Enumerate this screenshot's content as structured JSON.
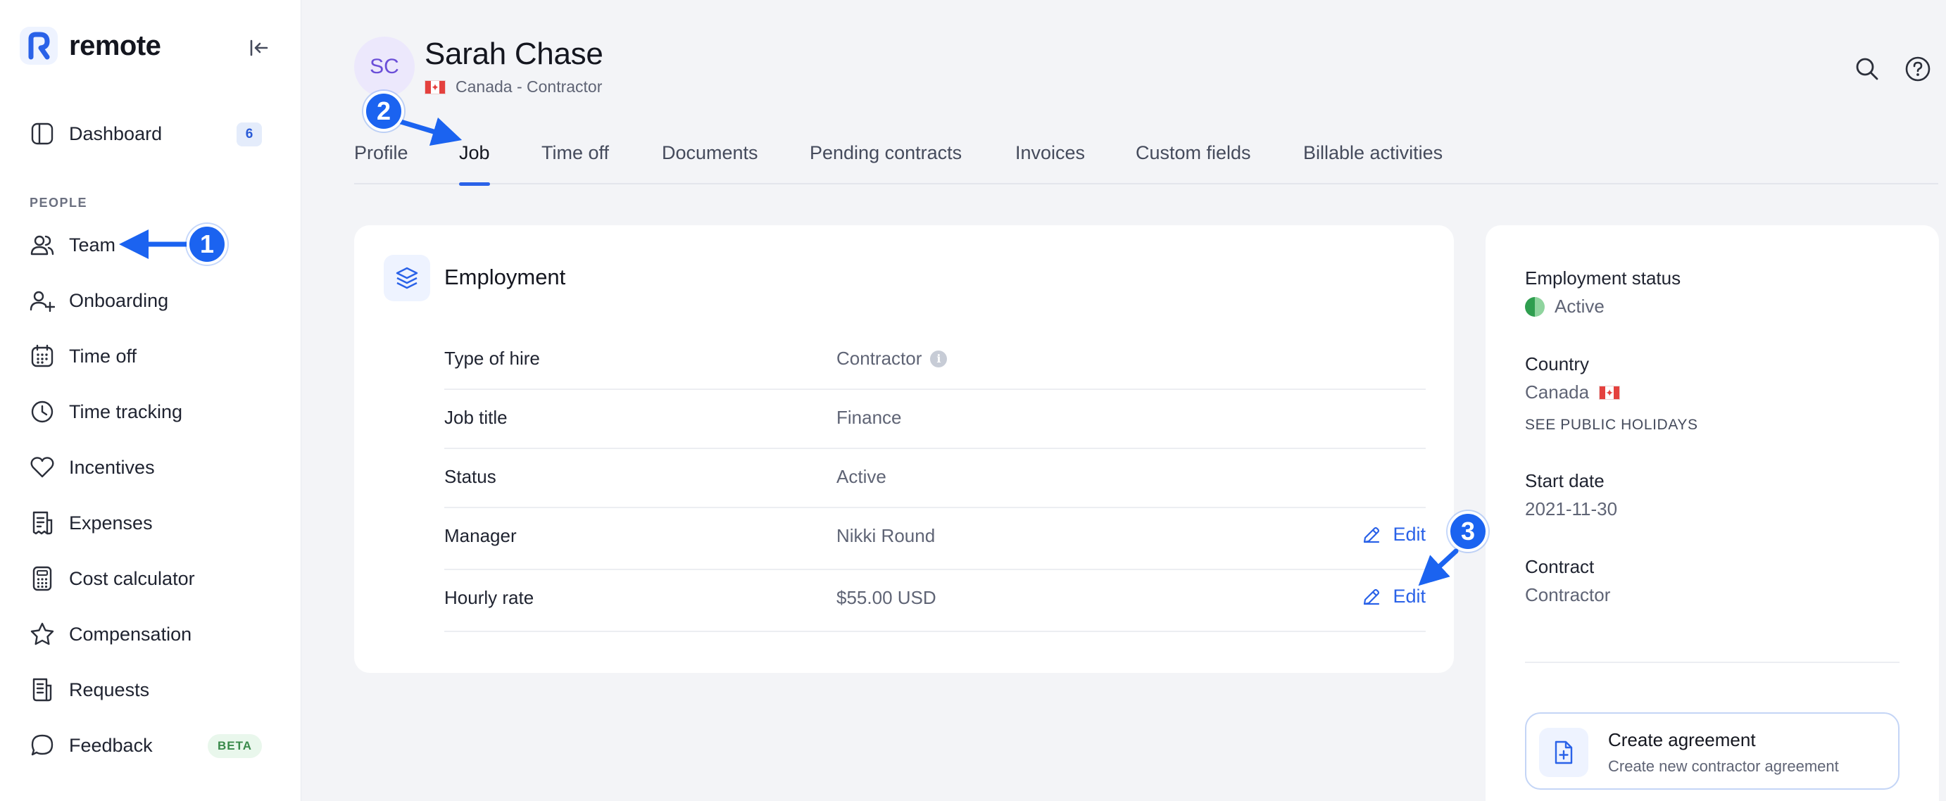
{
  "app": {
    "brand_name": "remote",
    "brand_color": "#2a62e8"
  },
  "sidebar": {
    "collapse_icon": "collapse-left-icon",
    "items_top": [
      {
        "label": "Dashboard",
        "icon": "dashboard-icon",
        "badge": "6"
      }
    ],
    "section_label": "PEOPLE",
    "items": [
      {
        "label": "Team",
        "icon": "team-icon"
      },
      {
        "label": "Onboarding",
        "icon": "add-user-icon"
      },
      {
        "label": "Time off",
        "icon": "calendar-icon"
      },
      {
        "label": "Time tracking",
        "icon": "clock-icon"
      },
      {
        "label": "Incentives",
        "icon": "heart-icon"
      },
      {
        "label": "Expenses",
        "icon": "receipt-icon"
      },
      {
        "label": "Cost calculator",
        "icon": "calculator-icon"
      },
      {
        "label": "Compensation",
        "icon": "star-icon"
      },
      {
        "label": "Requests",
        "icon": "document-list-icon"
      },
      {
        "label": "Feedback",
        "icon": "chat-bubble-icon",
        "tag": "BETA"
      }
    ]
  },
  "header": {
    "avatar_initials": "SC",
    "name": "Sarah Chase",
    "subtitle": "Canada - Contractor",
    "actions": [
      "search-icon",
      "help-icon"
    ]
  },
  "tabs": [
    "Profile",
    "Job",
    "Time off",
    "Documents",
    "Pending contracts",
    "Invoices",
    "Custom fields",
    "Billable activities"
  ],
  "active_tab": "Job",
  "employment": {
    "title": "Employment",
    "rows": [
      {
        "label": "Type of hire",
        "value": "Contractor",
        "info": "i"
      },
      {
        "label": "Job title",
        "value": "Finance"
      },
      {
        "label": "Status",
        "value": "Active"
      },
      {
        "label": "Manager",
        "value": "Nikki Round",
        "action": "Edit"
      },
      {
        "label": "Hourly rate",
        "value": "$55.00 USD",
        "action": "Edit"
      }
    ]
  },
  "summary": {
    "employment_status_label": "Employment status",
    "employment_status_value": "Active",
    "country_label": "Country",
    "country_value": "Canada",
    "public_holidays_link": "SEE PUBLIC HOLIDAYS",
    "start_date_label": "Start date",
    "start_date_value": "2021-11-30",
    "contract_label": "Contract",
    "contract_value": "Contractor",
    "agreement_title": "Create agreement",
    "agreement_subtitle": "Create new contractor agreement"
  },
  "annotations": {
    "marker_color": "#1b63f0",
    "steps": [
      "1",
      "2",
      "3"
    ]
  }
}
